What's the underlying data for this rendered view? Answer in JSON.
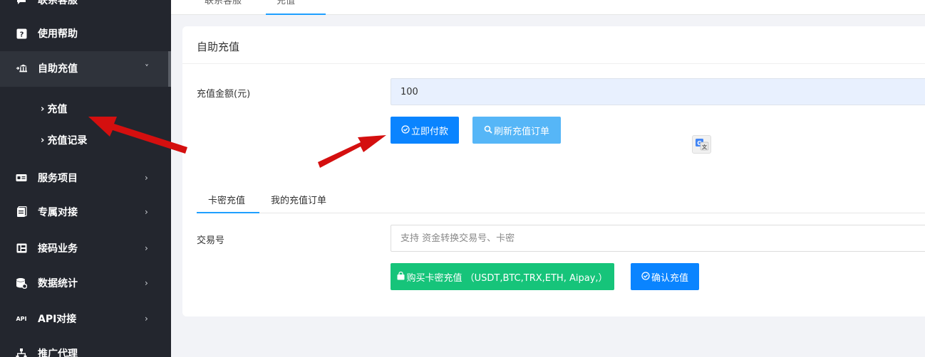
{
  "sidebar": {
    "items": [
      {
        "label": "联系客服",
        "icon": "chat-icon"
      },
      {
        "label": "使用帮助",
        "icon": "help-icon"
      },
      {
        "label": "自助充值",
        "icon": "bank-icon",
        "chevron": "˅"
      },
      {
        "label": "服务项目",
        "icon": "card-icon",
        "chevron": "›"
      },
      {
        "label": "专属对接",
        "icon": "doc-icon",
        "chevron": "›"
      },
      {
        "label": "接码业务",
        "icon": "grid-icon",
        "chevron": "›"
      },
      {
        "label": "数据统计",
        "icon": "database-icon",
        "chevron": "›"
      },
      {
        "label": "API对接",
        "icon": "api-icon",
        "chevron": "›",
        "icon_text": "API"
      },
      {
        "label": "推广代理",
        "icon": "network-icon"
      }
    ],
    "sub_items": [
      {
        "label": "充值"
      },
      {
        "label": "充值记录"
      }
    ],
    "caret": "›"
  },
  "tabbar": {
    "tabs": [
      {
        "label": "联系客服"
      },
      {
        "label": "充值"
      }
    ]
  },
  "card": {
    "title": "自助充值",
    "amount_label": "充值金额(元)",
    "amount_value": "100",
    "pay_button": "立即付款",
    "refresh_button": "刷新充值订单"
  },
  "subtabs": [
    {
      "label": "卡密充值"
    },
    {
      "label": "我的充值订单"
    }
  ],
  "trade": {
    "label": "交易号",
    "placeholder": "支持 资金转换交易号、卡密",
    "buy_button": "购买卡密充值 （USDT,BTC,TRX,ETH, Aipay,）",
    "confirm_button": "确认充值"
  },
  "colors": {
    "sidebar_bg": "#23262e",
    "primary": "#0a84ff",
    "secondary": "#56b6f7",
    "success": "#16c47a",
    "annotation_arrow": "#d40f0f"
  }
}
